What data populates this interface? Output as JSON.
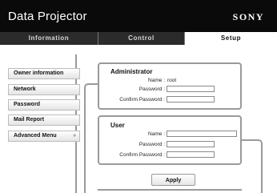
{
  "header": {
    "title": "Data Projector",
    "brand": "SONY"
  },
  "tabs": [
    {
      "label": "Information"
    },
    {
      "label": "Control"
    },
    {
      "label": "Setup"
    }
  ],
  "sidebar": {
    "items": [
      {
        "label": "Owner information"
      },
      {
        "label": "Network"
      },
      {
        "label": "Password"
      },
      {
        "label": "Mail Report"
      },
      {
        "label": "Advanced Menu"
      }
    ]
  },
  "administrator": {
    "title": "Administrator",
    "name_label": "Name :",
    "name_value": "root",
    "password_label": "Password :",
    "password_value": "",
    "confirm_label": "Confirm Password :",
    "confirm_value": ""
  },
  "user": {
    "title": "User",
    "name_label": "Name :",
    "name_value": "",
    "password_label": "Password :",
    "password_value": "",
    "confirm_label": "Confirm Password :",
    "confirm_value": ""
  },
  "actions": {
    "apply_label": "Apply"
  },
  "icons": {
    "advanced_menu_chevron": "double-chevron-down-icon"
  },
  "colors": {
    "header_bg": "#0a0a0a",
    "tab_bg": "#2b2b2b",
    "frame_gray": "#9a9a9a"
  }
}
